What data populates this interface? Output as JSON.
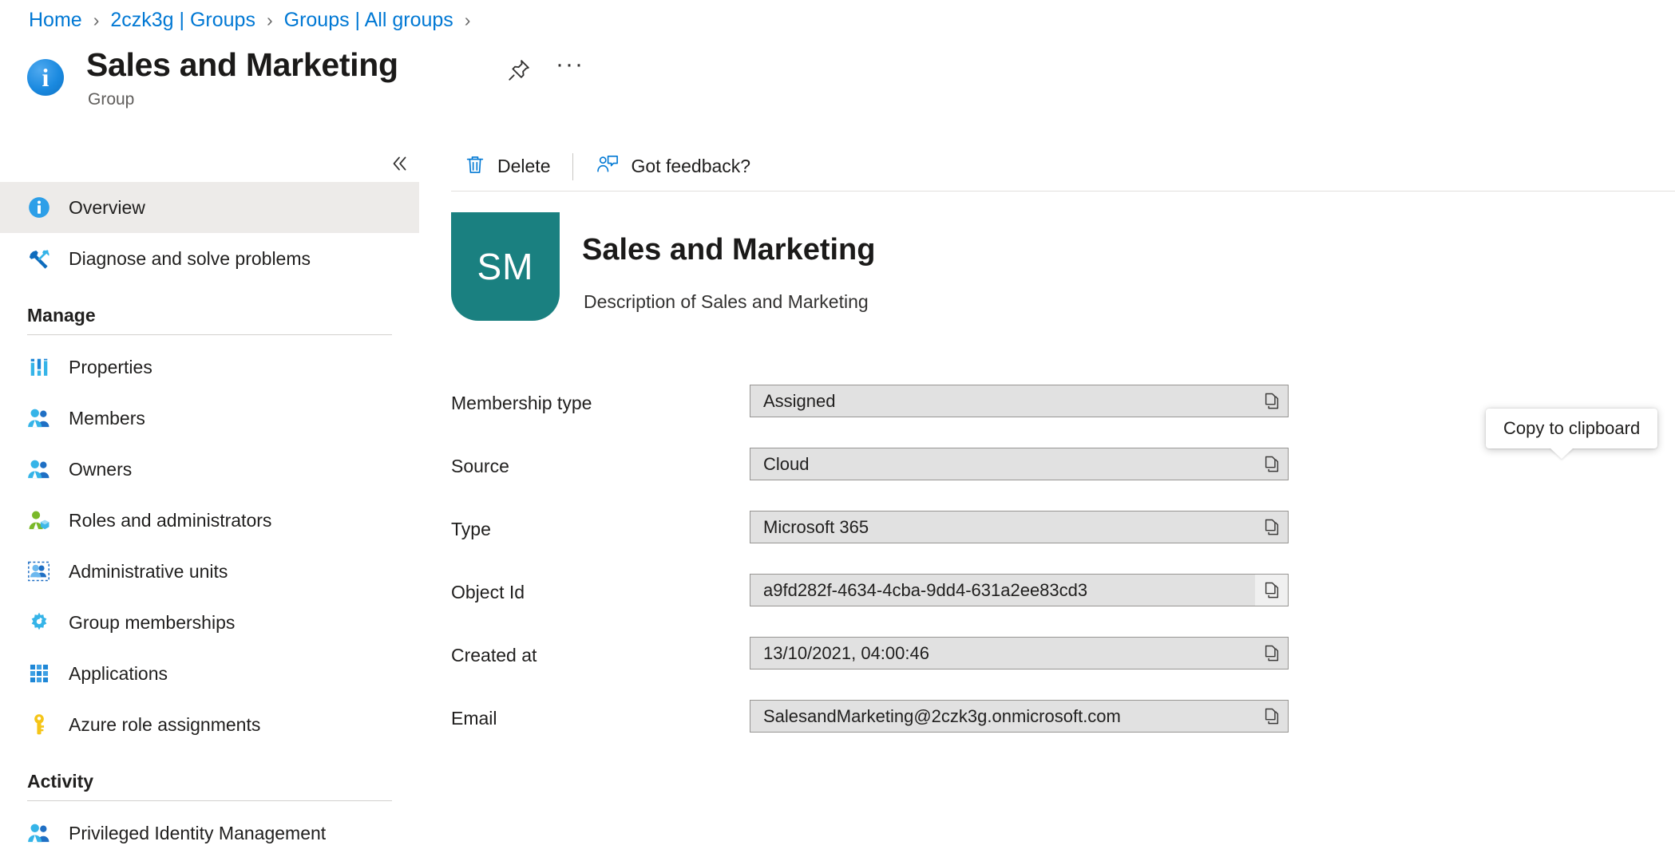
{
  "breadcrumb": {
    "items": [
      {
        "label": "Home"
      },
      {
        "label": "2czk3g | Groups"
      },
      {
        "label": "Groups | All groups"
      }
    ],
    "separator": "›"
  },
  "header": {
    "badge_icon": "info-icon",
    "badge_glyph": "i",
    "title": "Sales and Marketing",
    "subtitle": "Group",
    "pin_icon": "pin-icon",
    "more_icon": "ellipsis-icon",
    "more_glyph": "···"
  },
  "sidebar": {
    "collapse_icon": "chevron-double-left-icon",
    "collapse_glyph": "«",
    "items": [
      {
        "label": "Overview",
        "icon": "info-icon",
        "selected": true
      },
      {
        "label": "Diagnose and solve problems",
        "icon": "wrench-screwdriver-icon",
        "selected": false
      }
    ],
    "sections": [
      {
        "title": "Manage",
        "items": [
          {
            "label": "Properties",
            "icon": "properties-bars-icon"
          },
          {
            "label": "Members",
            "icon": "members-people-icon"
          },
          {
            "label": "Owners",
            "icon": "owners-people-icon"
          },
          {
            "label": "Roles and administrators",
            "icon": "roles-person-cube-icon"
          },
          {
            "label": "Administrative units",
            "icon": "administrative-units-icon"
          },
          {
            "label": "Group memberships",
            "icon": "gear-icon"
          },
          {
            "label": "Applications",
            "icon": "grid-apps-icon"
          },
          {
            "label": "Azure role assignments",
            "icon": "key-icon"
          }
        ]
      },
      {
        "title": "Activity",
        "items": [
          {
            "label": "Privileged Identity Management",
            "icon": "members-people-icon"
          }
        ]
      }
    ]
  },
  "toolbar": {
    "delete_label": "Delete",
    "delete_icon": "trash-icon",
    "feedback_label": "Got feedback?",
    "feedback_icon": "feedback-person-icon"
  },
  "group": {
    "initials": "SM",
    "tile_color": "#1a8080",
    "name": "Sales and Marketing",
    "description": "Description of Sales and Marketing"
  },
  "properties": [
    {
      "label": "Membership type",
      "value": "Assigned",
      "copy_icon": "copy-icon",
      "hovered": false
    },
    {
      "label": "Source",
      "value": "Cloud",
      "copy_icon": "copy-icon",
      "hovered": false
    },
    {
      "label": "Type",
      "value": "Microsoft 365",
      "copy_icon": "copy-icon",
      "hovered": false
    },
    {
      "label": "Object Id",
      "value": "a9fd282f-4634-4cba-9dd4-631a2ee83cd3",
      "copy_icon": "copy-icon",
      "hovered": true
    },
    {
      "label": "Created at",
      "value": "13/10/2021, 04:00:46",
      "copy_icon": "copy-icon",
      "hovered": false
    },
    {
      "label": "Email",
      "value": "SalesandMarketing@2czk3g.onmicrosoft.com",
      "copy_icon": "copy-icon",
      "hovered": false
    }
  ],
  "tooltip": {
    "text": "Copy to clipboard"
  },
  "colors": {
    "link": "#0078d4",
    "accent": "#0078d4",
    "tile": "#1a8080",
    "field_bg": "#e1e1e1",
    "field_border": "#979593",
    "selected_nav": "#edebe9"
  }
}
